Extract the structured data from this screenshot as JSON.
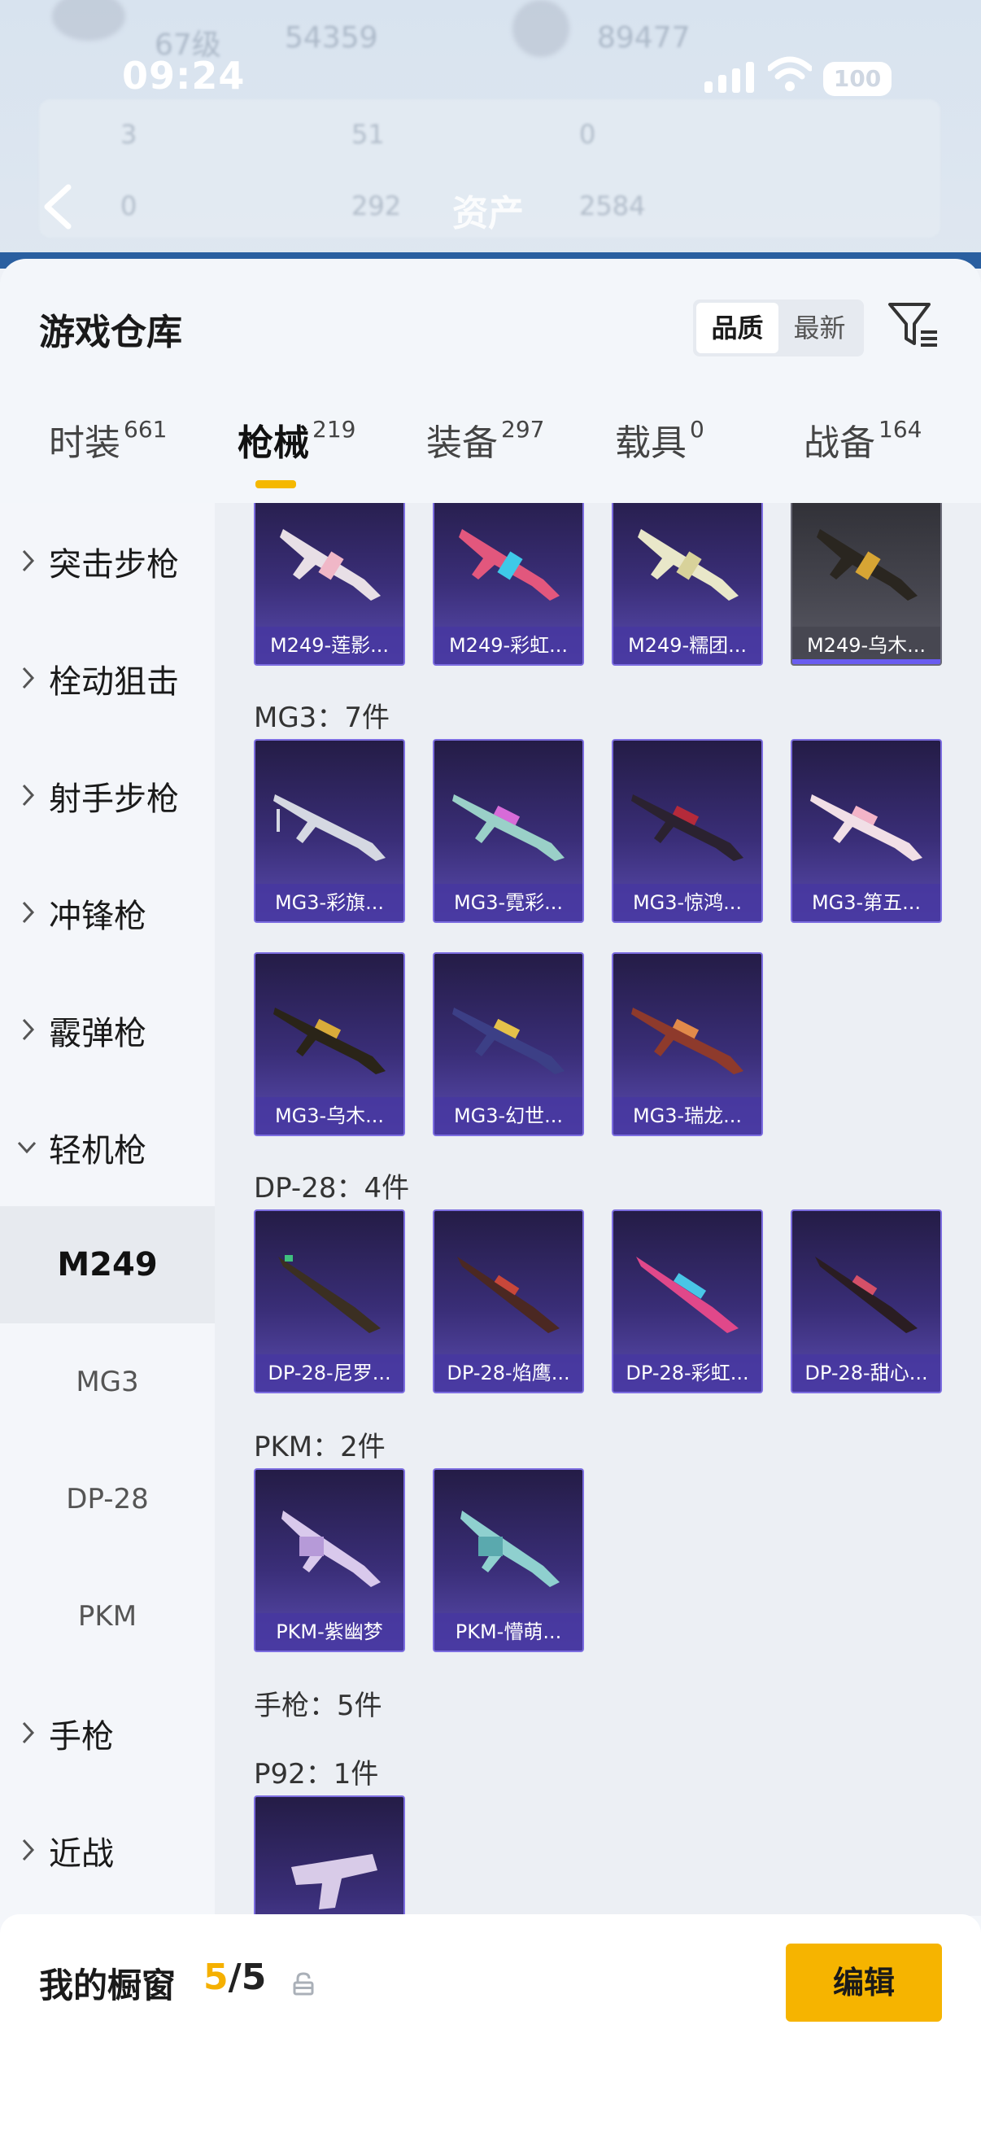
{
  "status_bar": {
    "time": "09:24",
    "battery": "100"
  },
  "header_bg": {
    "level": "67级",
    "coins": "54359",
    "other": "89477",
    "stats_row1": [
      "3",
      "51",
      "0"
    ],
    "stats_row2": [
      "0",
      "292",
      "2584"
    ],
    "title": "资产"
  },
  "sheet": {
    "title": "游戏仓库",
    "sort_options": [
      "品质",
      "最新"
    ],
    "active_sort": "品质"
  },
  "tabs": [
    {
      "label": "时装",
      "count": "661"
    },
    {
      "label": "枪械",
      "count": "219"
    },
    {
      "label": "装备",
      "count": "297"
    },
    {
      "label": "载具",
      "count": "0"
    },
    {
      "label": "战备",
      "count": "164"
    }
  ],
  "active_tab": "枪械",
  "sidebar": {
    "categories": [
      "突击步枪",
      "栓动狙击",
      "射手步枪",
      "冲锋枪",
      "霰弹枪",
      "轻机枪",
      "手枪",
      "近战"
    ],
    "subcategories": [
      "M249",
      "MG3",
      "DP-28",
      "PKM"
    ],
    "active_sub": "M249"
  },
  "sections": [
    {
      "label": "",
      "items": [
        "M249-莲影...",
        "M249-彩虹...",
        "M249-糯团...",
        "M249-乌木..."
      ]
    },
    {
      "label": "MG3：7件",
      "items": [
        "MG3-彩旗...",
        "MG3-霓彩...",
        "MG3-惊鸿...",
        "MG3-第五...",
        "MG3-乌木...",
        "MG3-幻世...",
        "MG3-瑞龙..."
      ]
    },
    {
      "label": "DP-28：4件",
      "items": [
        "DP-28-尼罗...",
        "DP-28-焰鹰...",
        "DP-28-彩虹...",
        "DP-28-甜心..."
      ]
    },
    {
      "label": "PKM：2件",
      "items": [
        "PKM-紫幽梦",
        "PKM-懵萌..."
      ]
    },
    {
      "label": "手枪：5件",
      "items": []
    },
    {
      "label": "P92：1件",
      "items": [
        ""
      ]
    }
  ],
  "showcase": {
    "label": "我的橱窗",
    "current": "5",
    "total": "/5",
    "edit_label": "编辑"
  },
  "colors": {
    "accent": "#f6b400",
    "item_purple": "#3a2e78",
    "item_border": "#7c6de0"
  },
  "icons": [
    "back-icon",
    "filter-icon",
    "chevron-right-icon",
    "chevron-down-icon",
    "share-icon",
    "lock-icon"
  ]
}
